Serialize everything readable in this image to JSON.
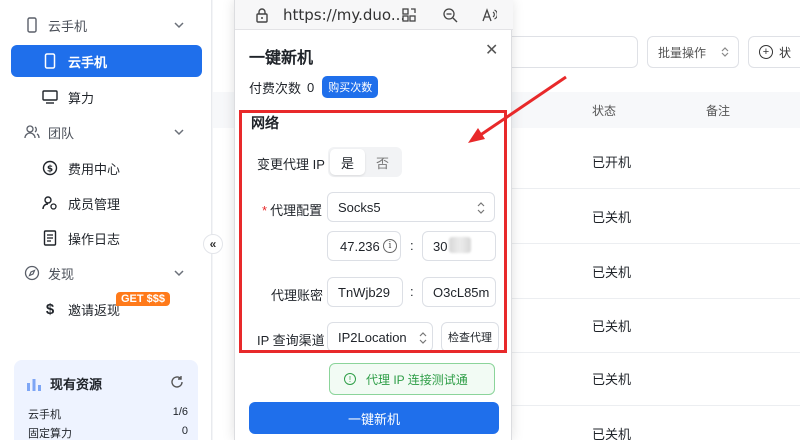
{
  "sidebar": {
    "groups": [
      {
        "label": "云手机",
        "icon": "phone-outline-icon"
      },
      {
        "label": "团队",
        "icon": "team-icon"
      },
      {
        "label": "发现",
        "icon": "compass-icon"
      }
    ],
    "items": [
      {
        "label": "云手机",
        "icon": "phone-icon",
        "active": true
      },
      {
        "label": "算力",
        "icon": "monitor-icon"
      },
      {
        "label": "费用中心",
        "icon": "dollar-circle-icon"
      },
      {
        "label": "成员管理",
        "icon": "members-icon"
      },
      {
        "label": "操作日志",
        "icon": "log-icon"
      },
      {
        "label": "邀请返现",
        "icon": "dollar-icon"
      }
    ],
    "badge": "GET $$$",
    "resources": {
      "title": "现有资源",
      "rows": [
        {
          "label": "云手机",
          "value": "1/6"
        },
        {
          "label": "固定算力",
          "value": "0"
        }
      ]
    }
  },
  "toolbar": {
    "batch_label": "批量操作",
    "state_label": "状"
  },
  "table": {
    "headers": {
      "status": "状态",
      "remark": "备注"
    },
    "rows": [
      "已开机",
      "已关机",
      "已关机",
      "已关机",
      "已关机",
      "已关机"
    ]
  },
  "browser": {
    "url": "https://my.duo..."
  },
  "dialog": {
    "title": "一键新机",
    "pay_label": "付费次数",
    "pay_count": "0",
    "buy_label": "购买次数",
    "section_title": "网络",
    "change_proxy_label": "变更代理 IP",
    "toggle_yes": "是",
    "toggle_no": "否",
    "proxy_config_label": "代理配置",
    "proxy_type": "Socks5",
    "ip_value": "47.236",
    "port_value": "30",
    "account_label": "代理账密",
    "username": "TnWjb29",
    "password": "O3cL85m",
    "channel_label": "IP 查询渠道",
    "channel_value": "IP2Location",
    "check_label": "检查代理",
    "success_msg": "代理 IP 连接测试通",
    "submit_label": "一键新机"
  },
  "colors": {
    "accent": "#1f6feb",
    "highlight": "#e8292a",
    "success": "#2e9e47"
  }
}
